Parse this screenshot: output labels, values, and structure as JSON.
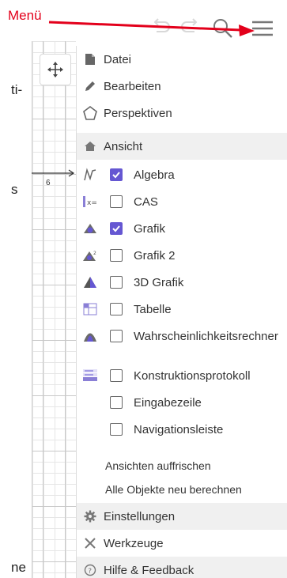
{
  "annotation": {
    "label": "Menü",
    "color": "#e3001b"
  },
  "doc_fragments": {
    "frag1": "ti-",
    "frag2": "s",
    "frag3": "ne"
  },
  "grid": {
    "axis_label": "6"
  },
  "menu": {
    "main_items": [
      {
        "label": "Datei",
        "icon": "file-icon"
      },
      {
        "label": "Bearbeiten",
        "icon": "pencil-icon"
      },
      {
        "label": "Perspektiven",
        "icon": "perspectives-icon"
      },
      {
        "label": "Ansicht",
        "icon": "home-icon"
      }
    ],
    "views": [
      {
        "label": "Algebra",
        "checked": true,
        "icon": "algebra-view-icon"
      },
      {
        "label": "CAS",
        "checked": false,
        "icon": "cas-view-icon"
      },
      {
        "label": "Grafik",
        "checked": true,
        "icon": "graphics-view-icon"
      },
      {
        "label": "Grafik 2",
        "checked": false,
        "icon": "graphics2-view-icon"
      },
      {
        "label": "3D Grafik",
        "checked": false,
        "icon": "graphics3d-view-icon"
      },
      {
        "label": "Tabelle",
        "checked": false,
        "icon": "spreadsheet-view-icon"
      },
      {
        "label": "Wahrscheinlichkeitsrechner",
        "checked": false,
        "icon": "probability-view-icon"
      },
      {
        "label": "Konstruktionsprotokoll",
        "checked": false,
        "icon": "construction-protocol-icon"
      },
      {
        "label": "Eingabezeile",
        "checked": false,
        "icon": ""
      },
      {
        "label": "Navigationsleiste",
        "checked": false,
        "icon": ""
      }
    ],
    "actions": {
      "refresh": "Ansichten auffrischen",
      "recompute": "Alle Objekte neu berechnen"
    },
    "bottom_items": [
      {
        "label": "Einstellungen",
        "icon": "gear-icon"
      },
      {
        "label": "Werkzeuge",
        "icon": "tools-icon"
      },
      {
        "label": "Hilfe & Feedback",
        "icon": "help-icon"
      }
    ]
  },
  "colors": {
    "accent": "#6557d2",
    "annotation": "#e3001b"
  }
}
